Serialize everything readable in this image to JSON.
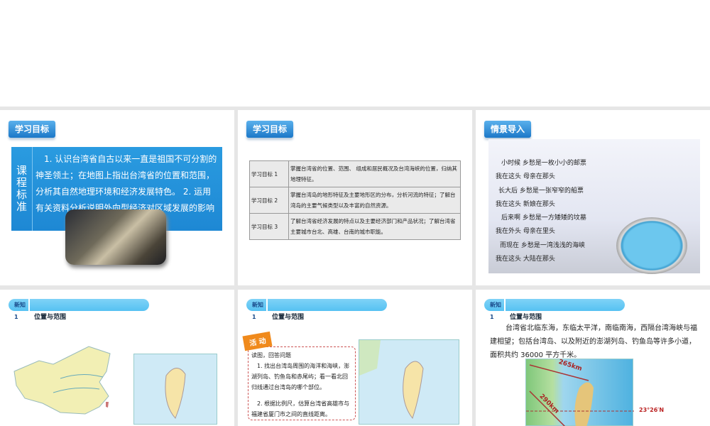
{
  "slides": [
    {
      "badge": "学习目标",
      "std_label": "课程标准",
      "std_text": "1. 认识台湾省自古以来一直是祖国不可分割的神圣领土；在地图上指出台湾省的位置和范围，分析其自然地理环境和经济发展特色。 2. 运用有关资料分析说明外向型经济对区域发展的影响"
    },
    {
      "badge": "学习目标",
      "rows": [
        {
          "h": "学习目标 1",
          "t": "掌握台湾省的位置、范围、 组成和居民概况及台湾海峡的位置，归纳其地理特征。"
        },
        {
          "h": "学习目标 2",
          "t": "掌握台湾岛的地形特征及主要地形区的分布，分析河流的特征；了解台湾岛的主要气候类型以及丰富的自然资源。"
        },
        {
          "h": "学习目标 3",
          "t": "了解台湾省经济发展的特点以及主要经济部门和产品状况；了解台湾省主要城市台北、高雄、台南的城市职能。"
        }
      ]
    },
    {
      "badge": "情景导入",
      "poem": [
        "小时候 乡愁是一枚小小的邮票",
        "我在这头 母亲在那头",
        "长大后 乡愁是一张窄窄的船票",
        "我在这头 新娘在那头",
        "后来啊 乡愁是一方矮矮的坟墓",
        "我在外头 母亲在里头",
        "而现在 乡愁是一湾浅浅的海峡",
        "我在这头 大陆在那头"
      ]
    },
    {
      "tag": "新知 1",
      "title": "位置与范围"
    },
    {
      "tag": "新知 1",
      "title": "位置与范围",
      "activity": "活 动",
      "lines": [
        "读图，回答问题",
        "1. 找出台湾岛周围的海洋和海峡，澎湖列岛、钓鱼岛和赤尾屿；看一看北回归线通过台湾岛的哪个部位。",
        "2. 根据比例尺，估算台湾省高雄市与福建省厦门市之间的直线距离。"
      ]
    },
    {
      "tag": "新知 1",
      "title": "位置与范围",
      "para": "台湾省北临东海，东临太平洋，南临南海，西隔台湾海峡与福建相望；包括台湾岛、以及附近的澎湖列岛、钓鱼岛等许多小道，面积共约 36000 平方千米。",
      "d1": "265km",
      "d2": "290km",
      "lat": "23°26′N"
    }
  ]
}
